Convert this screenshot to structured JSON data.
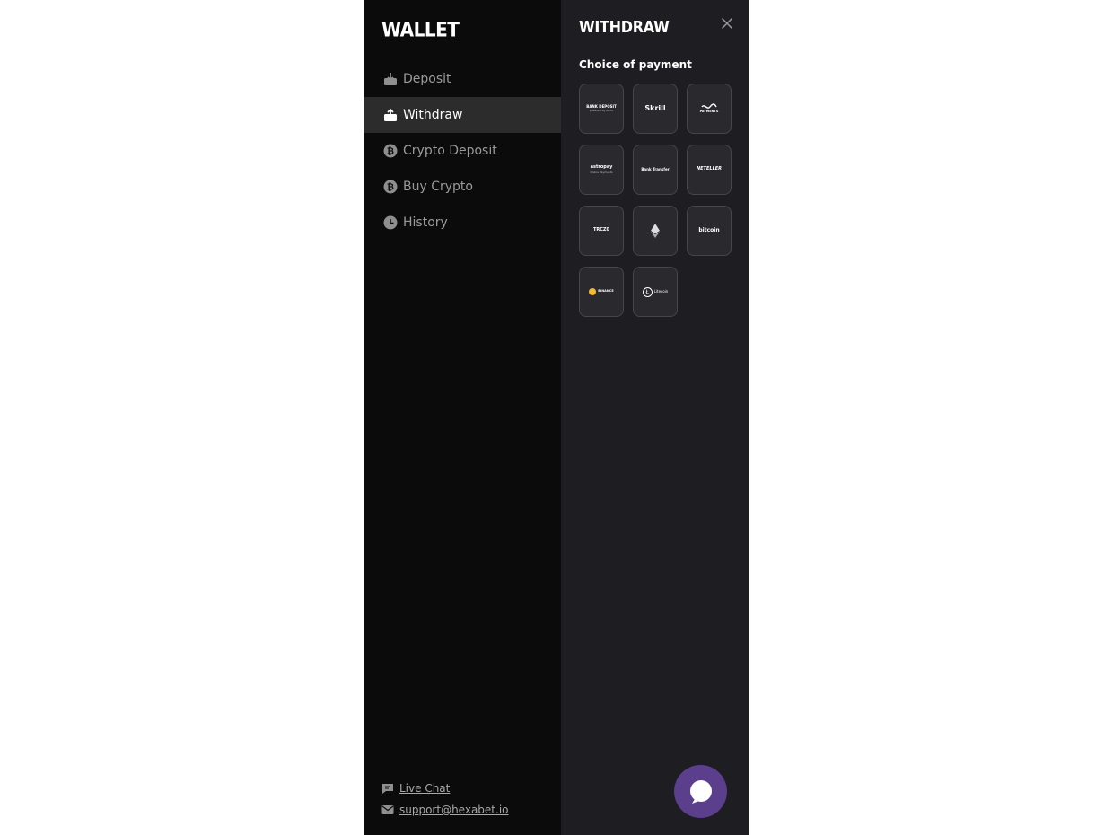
{
  "sidebar": {
    "title": "WALLET",
    "items": [
      {
        "label": "Deposit",
        "icon": "deposit-icon",
        "active": false
      },
      {
        "label": "Withdraw",
        "icon": "withdraw-icon",
        "active": true
      },
      {
        "label": "Crypto Deposit",
        "icon": "bitcoin-icon",
        "active": false
      },
      {
        "label": "Buy Crypto",
        "icon": "bitcoin-icon",
        "active": false
      },
      {
        "label": "History",
        "icon": "clock-icon",
        "active": false
      }
    ],
    "footer": {
      "live_chat": "Live Chat",
      "support_email": "support@hexabet.io"
    }
  },
  "main": {
    "title": "WITHDRAW",
    "subtitle": "Choice of payment",
    "payment_methods": [
      {
        "name": "BANK DEPOSIT",
        "sub": "powered by ZOTA"
      },
      {
        "name": "Skrill",
        "sub": ""
      },
      {
        "name": "PAYMENTS",
        "sub": ""
      },
      {
        "name": "astropay",
        "sub": "Online Payments"
      },
      {
        "name": "Bank Transfer",
        "sub": ""
      },
      {
        "name": "NETELLER",
        "sub": ""
      },
      {
        "name": "TRCZ0",
        "sub": ""
      },
      {
        "name": "",
        "sub": ""
      },
      {
        "name": "bitcoin",
        "sub": ""
      },
      {
        "name": "BINANCE",
        "sub": ""
      },
      {
        "name": "Litecoin",
        "sub": ""
      }
    ]
  },
  "colors": {
    "sidebar_bg": "#0b0b0b",
    "content_bg": "#1e1d21",
    "active_item_bg": "#2c2c2d",
    "tile_bg": "#2a292e",
    "chat_button": "#5b3e8c"
  }
}
